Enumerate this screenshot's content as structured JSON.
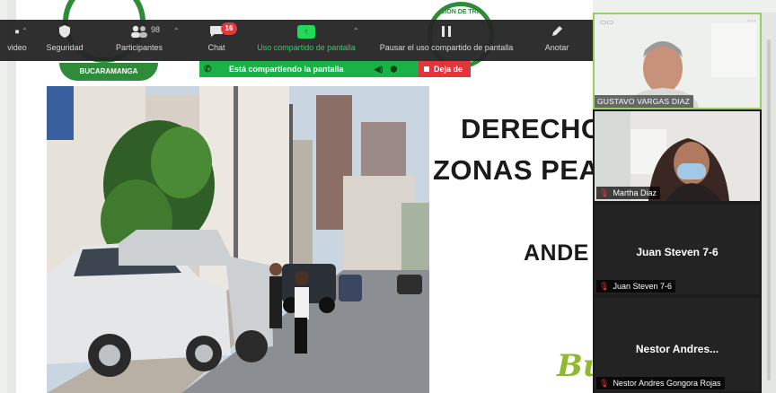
{
  "toolbar": {
    "video_label": "video",
    "security_label": "Seguridad",
    "participants_label": "Participantes",
    "participants_count": "98",
    "chat_label": "Chat",
    "chat_badge": "16",
    "share_label": "Uso compartido de pantalla",
    "pause_label": "Pausar el uso compartido de pantalla",
    "annotate_label": "Anotar"
  },
  "sharebar": {
    "status_text": "Está compartiendo la pantalla",
    "stop_label": "Deja de"
  },
  "slide": {
    "logo_text_top": "CIÓN DE TRÁ",
    "logo_text_bottom": "BUCARAMANGA",
    "title_line1": "DERECHO",
    "title_line2": "ZONAS PEA",
    "title_line3": "ANDE",
    "footer_logo": "Bu"
  },
  "participants": [
    {
      "name": "GUSTAVO VARGAS DIAZ",
      "video": true,
      "muted": false
    },
    {
      "name": "Martha Diaz",
      "video": true,
      "muted": true
    },
    {
      "name": "Juan Steven 7-6",
      "display_name": "Juan Steven 7-6",
      "video": false,
      "muted": true
    },
    {
      "name": "Nestor Andres Gongora Rojas",
      "display_name": "Nestor Andres...",
      "video": false,
      "muted": true
    }
  ],
  "colors": {
    "toolbar_bg": "#262626",
    "share_green": "#23d959",
    "sharebar_green": "#19b246",
    "stop_red": "#e2353b",
    "brand_green": "#2d8b3a"
  },
  "icons": {
    "video": "video-icon",
    "security": "shield-icon",
    "participants": "people-icon",
    "chat": "chat-icon",
    "share": "share-screen-icon",
    "pause": "pause-icon",
    "annotate": "pen-icon",
    "muted": "mic-muted-icon"
  }
}
